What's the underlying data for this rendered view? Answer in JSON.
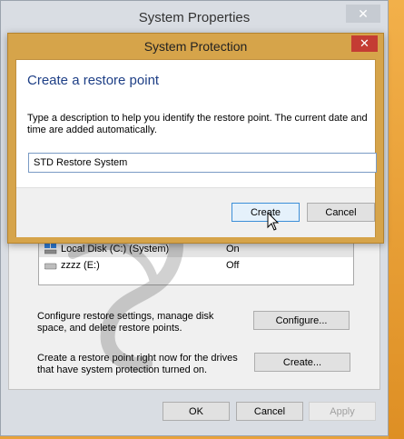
{
  "back_window": {
    "title": "System Properties",
    "close_glyph": "✕",
    "drives": [
      {
        "name": "Local Disk (C:) (System)",
        "status": "On",
        "icon": "system-drive-icon"
      },
      {
        "name": "zzzz (E:)",
        "status": "Off",
        "icon": "drive-icon"
      }
    ],
    "configure_text": "Configure restore settings, manage disk space, and delete restore points.",
    "configure_label": "Configure...",
    "create_text": "Create a restore point right now for the drives that have system protection turned on.",
    "create_label": "Create...",
    "ok_label": "OK",
    "cancel_label": "Cancel",
    "apply_label": "Apply"
  },
  "dialog": {
    "title": "System Protection",
    "close_glyph": "✕",
    "heading": "Create a restore point",
    "description": "Type a description to help you identify the restore point. The current date and time are added automatically.",
    "input_value": "STD Restore System",
    "create_label": "Create",
    "cancel_label": "Cancel"
  },
  "colors": {
    "accent_title": "#1e3f86",
    "dialog_frame": "#d6a44a",
    "close_red": "#c43c33"
  }
}
